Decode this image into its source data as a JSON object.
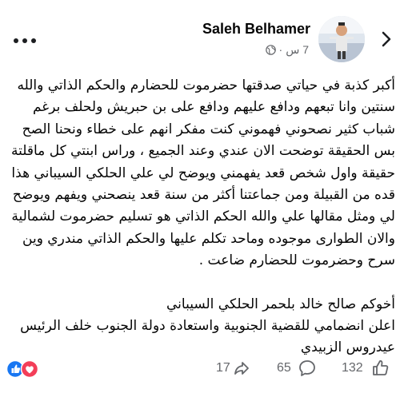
{
  "header": {
    "author_name": "Saleh Belhamer",
    "timestamp": "7 س",
    "separator": "·",
    "privacy_icon": "globe-icon",
    "back_icon": "chevron-right-icon",
    "more_icon": "more-dots-icon"
  },
  "post": {
    "paragraph_1": "أكبر كذبة في حياتي صدقتها حضرموت للحضارم والحكم الذاتي والله سنتين وانا تبعهم ودافع عليهم ودافع على بن حبريش ولحلف برغم شباب كثير نصحوني فهموني كنت مفكر انهم على خطاء ونحنا الصح بس الحقيقة توضحت الان عندي وعند الجميع ، وراس ابنتي كل ماقلتة حقيقة واول شخص قعد يفهمني ويوضح لي علي الحلكي السيباني هذا قده من القبيلة ومن جماعتنا أكثر من سنة قعد ينصحني ويفهم ويوضح لي ومثل مقالها علي والله الحكم الذاتي هو تسليم حضرموت لشمالية والان الطوارى موجوده وماحد تكلم عليها والحكم الذاتي مندري وين سرح وحضرموت للحضارم ضاعت .",
    "paragraph_2": "أخوكم صالح خالد بلحمر الحلكي السيباني",
    "paragraph_3": "اعلن انضمامي للقضية الجنوبية واستعادة دولة الجنوب خلف الرئيس عيدروس الزبيدي"
  },
  "stats": {
    "reactions_icons": [
      "like-icon",
      "love-icon"
    ],
    "likes_count": "132",
    "comments_count": "65",
    "shares_count": "17",
    "like_icon": "thumbs-up-icon",
    "comment_icon": "comment-icon",
    "share_icon": "share-icon"
  },
  "colors": {
    "text": "#050505",
    "secondary": "#65676b",
    "like_blue": "#1877f2",
    "love_red": "#f33e58"
  }
}
